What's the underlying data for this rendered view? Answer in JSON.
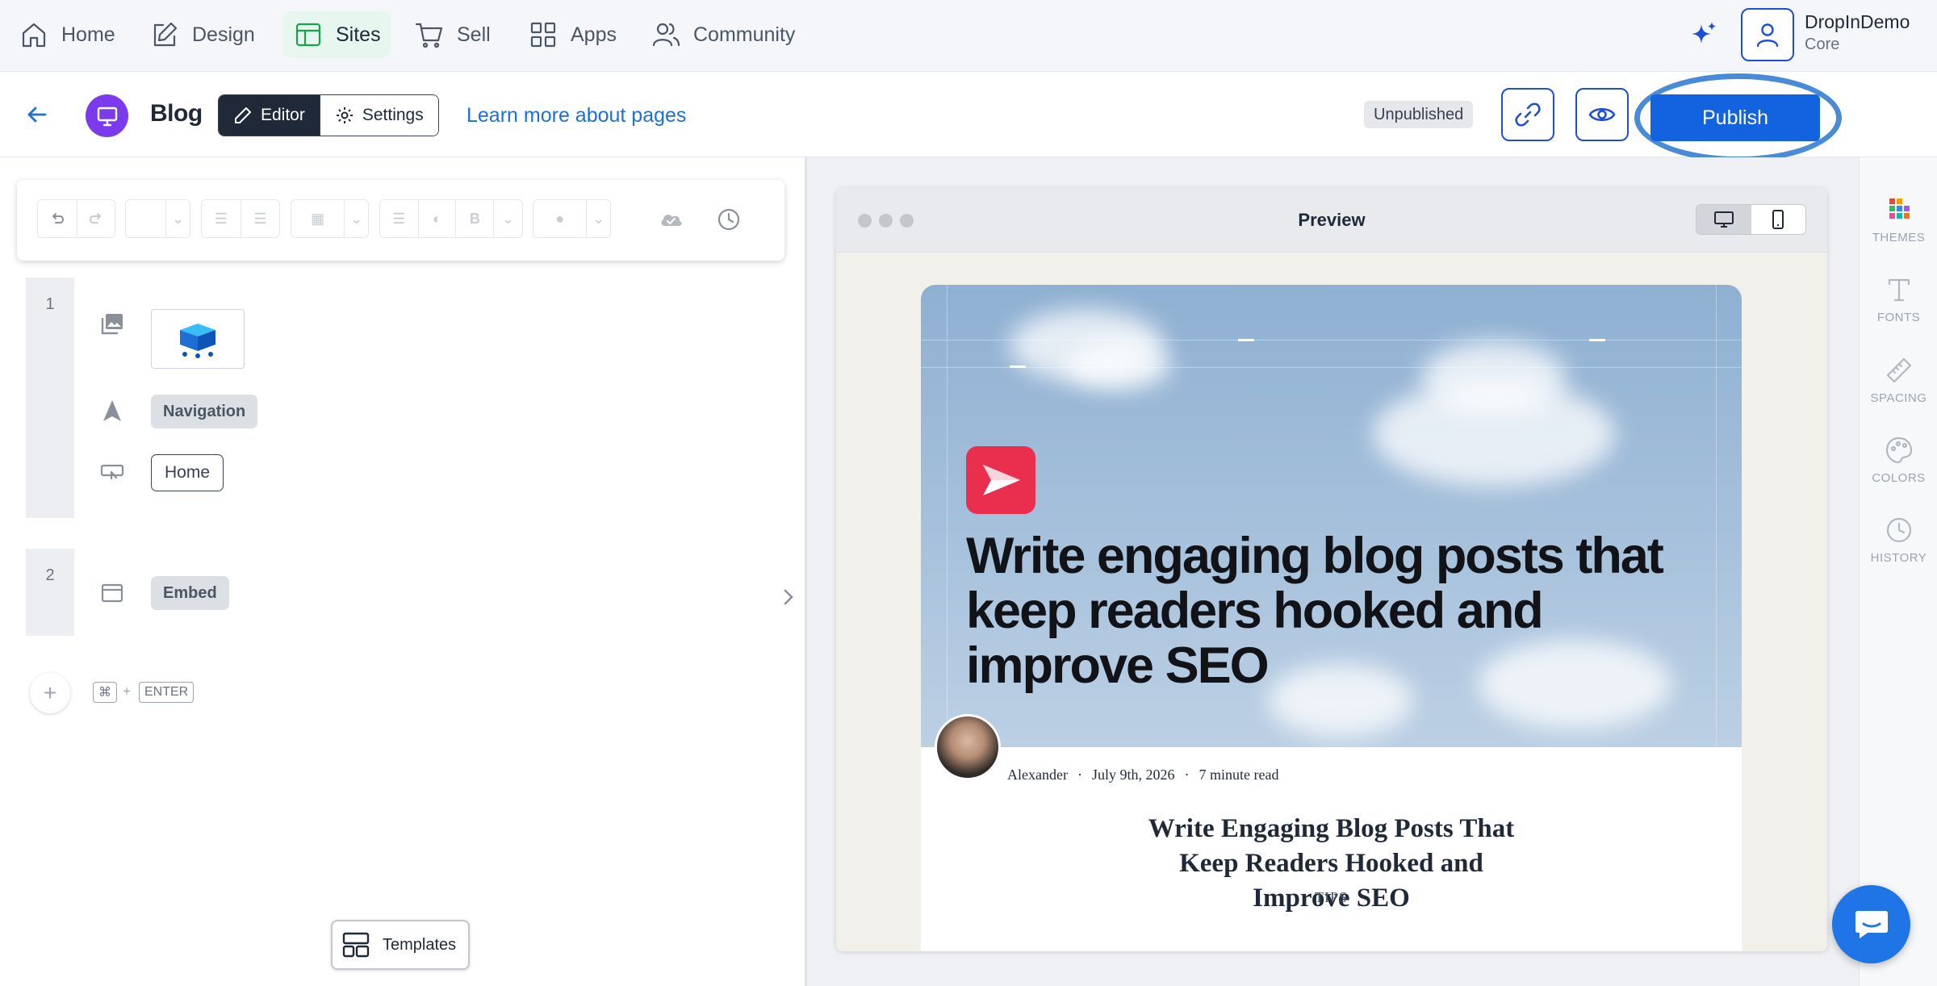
{
  "topnav": {
    "items": [
      {
        "label": "Home",
        "icon": "home-icon"
      },
      {
        "label": "Design",
        "icon": "pencil-square-icon"
      },
      {
        "label": "Sites",
        "icon": "layout-icon",
        "active": true
      },
      {
        "label": "Sell",
        "icon": "cart-icon"
      },
      {
        "label": "Apps",
        "icon": "grid-icon"
      },
      {
        "label": "Community",
        "icon": "users-icon"
      }
    ],
    "user": {
      "name": "DropInDemo",
      "plan": "Core"
    }
  },
  "header": {
    "page_title": "Blog",
    "editor_label": "Editor",
    "settings_label": "Settings",
    "learn_link": "Learn more about pages",
    "status_badge": "Unpublished",
    "publish_label": "Publish"
  },
  "editor": {
    "blocks": [
      {
        "number": "1",
        "navigation_label": "Navigation",
        "home_label": "Home"
      },
      {
        "number": "2",
        "embed_label": "Embed"
      }
    ],
    "shortcut": {
      "key1": "⌘",
      "plus": "+",
      "key2": "ENTER"
    },
    "templates_label": "Templates"
  },
  "preview": {
    "title": "Preview",
    "hero_title": "Write engaging blog posts that keep readers hooked and improve SEO",
    "author": "Alexander",
    "date": "July 9th, 2026",
    "read_time": "7 minute read",
    "separator": "·",
    "post_title": "Write Engaging Blog Posts That Keep Readers Hooked and Improve SEO",
    "tag": "TIPS"
  },
  "right_rail": {
    "items": [
      "THEMES",
      "FONTS",
      "SPACING",
      "COLORS",
      "HISTORY"
    ]
  },
  "colors": {
    "accent_blue": "#1363e0",
    "sites_active": "#16a34a",
    "brand_red": "#ea2e4e",
    "page_icon_purple": "#7c3aed"
  }
}
